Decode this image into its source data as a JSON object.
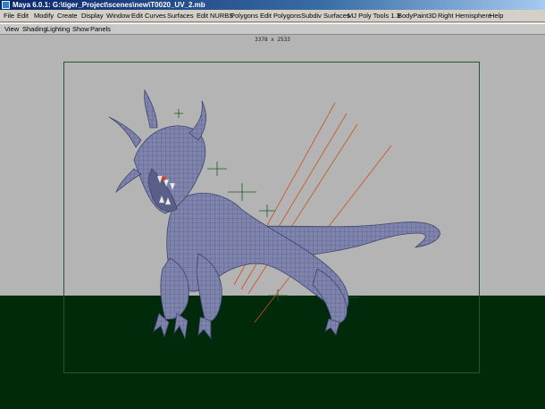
{
  "window": {
    "title": "Maya 6.0.1: G:\\tiger_Project\\scenes\\new\\T0020_UV_2.mb"
  },
  "menubar": {
    "items": [
      "File",
      "Edit",
      "Modify",
      "Create",
      "Display",
      "Window",
      "Edit Curves",
      "Surfaces",
      "Edit NURBS",
      "Polygons",
      "Edit Polygons",
      "Subdiv Surfaces",
      "MJ Poly Tools 1.3",
      "BodyPaint3D",
      "Right Hemisphere",
      "Help"
    ]
  },
  "panel_menu": {
    "items": [
      "View",
      "Shading",
      "Lighting",
      "Show",
      "Panels"
    ]
  },
  "viewport": {
    "resolution": "3378 x 2533",
    "background_color": "#b4b4b4",
    "floor_color": "#002a0a",
    "model": "creature-mesh",
    "wireframe_color": "#6a6f9a"
  }
}
